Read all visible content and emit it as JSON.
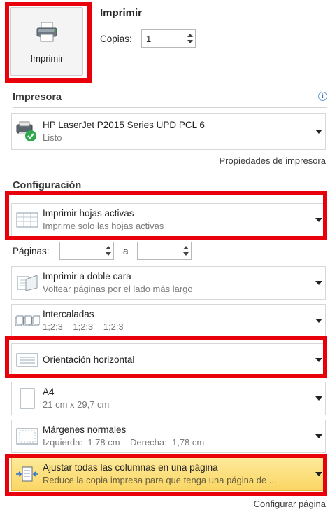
{
  "print": {
    "title": "Imprimir",
    "button_label": "Imprimir",
    "copies_label": "Copias:",
    "copies_value": "1"
  },
  "printer": {
    "section_title": "Impresora",
    "info_icon": "info-icon",
    "name": "HP LaserJet P2015 Series UPD PCL 6",
    "status": "Listo",
    "properties_link": "Propiedades de impresora"
  },
  "settings": {
    "section_title": "Configuración",
    "scope": {
      "main": "Imprimir hojas activas",
      "sub": "Imprime solo las hojas activas"
    },
    "pages_label": "Páginas:",
    "pages_to_label": "a",
    "duplex": {
      "main": "Imprimir a doble cara",
      "sub": "Voltear páginas por el lado más largo"
    },
    "collate": {
      "main": "Intercaladas",
      "sub": "1;2;3    1;2;3    1;2;3"
    },
    "orientation": {
      "main": "Orientación horizontal"
    },
    "paper": {
      "main": "A4",
      "sub": "21 cm x 29,7 cm"
    },
    "margins": {
      "main": "Márgenes normales",
      "sub": "Izquierda:  1,78 cm    Derecha:  1,78 cm"
    },
    "scaling": {
      "main": "Ajustar todas las columnas en una página",
      "sub": "Reduce la copia impresa para que tenga una página de ..."
    },
    "page_setup_link": "Configurar página"
  },
  "colors": {
    "highlight": "#e8000a",
    "selected_bg": "#fbd664"
  }
}
